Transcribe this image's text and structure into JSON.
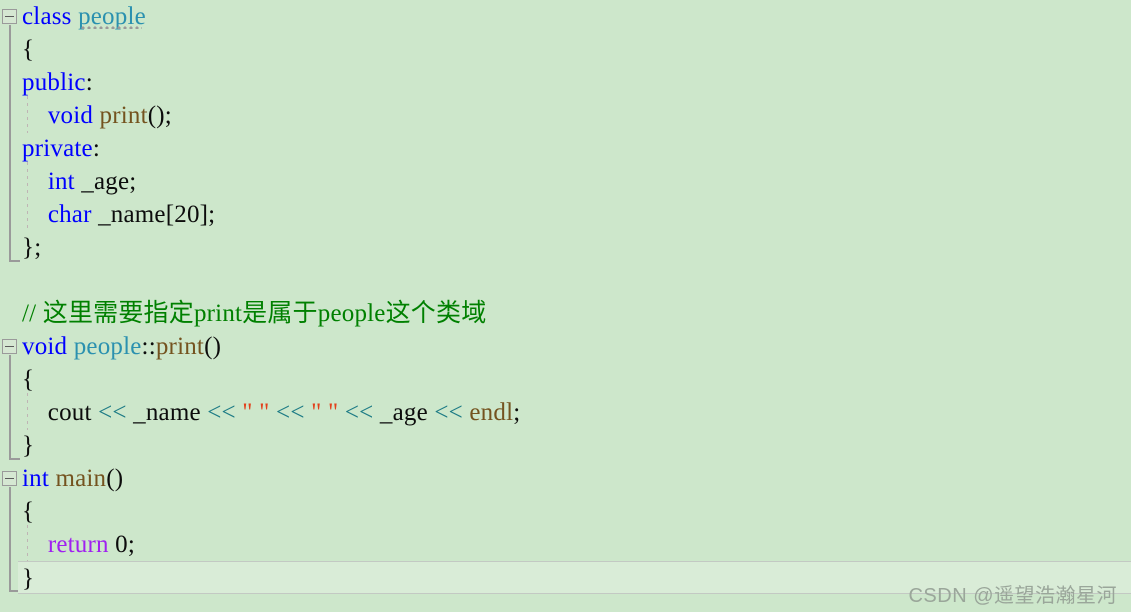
{
  "editor": {
    "background_color": "#cde7cb",
    "current_line_color": "#d9ecd7",
    "language": "C++"
  },
  "palette": {
    "keyword": "#0000ff",
    "user_type": "#2b91af",
    "function": "#74531f",
    "return_keyword": "#a020f0",
    "stream_operator": "#1d7b85",
    "string": "#e2401b",
    "comment": "#008000",
    "plain": "#0c0c0c",
    "fold_marker": "#9a9a9a",
    "watermark": "#9aa69a"
  },
  "code": {
    "lines": [
      {
        "n": 1,
        "indent": 0,
        "fold": "open",
        "tokens": [
          {
            "t": "class",
            "c": "kw"
          },
          {
            "t": " ",
            "c": "pl"
          },
          {
            "t": "people",
            "c": "type",
            "hint": true
          }
        ]
      },
      {
        "n": 2,
        "indent": 0,
        "tokens": [
          {
            "t": "{",
            "c": "pl"
          }
        ]
      },
      {
        "n": 3,
        "indent": 0,
        "tokens": [
          {
            "t": "public",
            "c": "kw"
          },
          {
            "t": ":",
            "c": "pl"
          }
        ]
      },
      {
        "n": 4,
        "indent": 1,
        "tokens": [
          {
            "t": "    ",
            "c": "pl"
          },
          {
            "t": "void",
            "c": "kw"
          },
          {
            "t": " ",
            "c": "pl"
          },
          {
            "t": "print",
            "c": "fn"
          },
          {
            "t": "();",
            "c": "pl"
          }
        ]
      },
      {
        "n": 5,
        "indent": 0,
        "tokens": [
          {
            "t": "private",
            "c": "kw"
          },
          {
            "t": ":",
            "c": "pl"
          }
        ]
      },
      {
        "n": 6,
        "indent": 1,
        "tokens": [
          {
            "t": "    ",
            "c": "pl"
          },
          {
            "t": "int",
            "c": "kw"
          },
          {
            "t": " _age;",
            "c": "pl"
          }
        ]
      },
      {
        "n": 7,
        "indent": 1,
        "tokens": [
          {
            "t": "    ",
            "c": "pl"
          },
          {
            "t": "char",
            "c": "kw"
          },
          {
            "t": " _name[20];",
            "c": "pl"
          }
        ]
      },
      {
        "n": 8,
        "indent": 0,
        "tokens": [
          {
            "t": "};",
            "c": "pl"
          }
        ]
      },
      {
        "n": 9,
        "indent": 0,
        "tokens": [
          {
            "t": "",
            "c": "pl"
          }
        ]
      },
      {
        "n": 10,
        "indent": 0,
        "tokens": [
          {
            "t": "// 这里需要指定print是属于people这个类域",
            "c": "cmt"
          }
        ]
      },
      {
        "n": 11,
        "indent": 0,
        "fold": "open",
        "tokens": [
          {
            "t": "void",
            "c": "kw"
          },
          {
            "t": " ",
            "c": "pl"
          },
          {
            "t": "people",
            "c": "type"
          },
          {
            "t": "::",
            "c": "pl"
          },
          {
            "t": "print",
            "c": "fn"
          },
          {
            "t": "()",
            "c": "pl"
          }
        ]
      },
      {
        "n": 12,
        "indent": 0,
        "tokens": [
          {
            "t": "{",
            "c": "pl"
          }
        ]
      },
      {
        "n": 13,
        "indent": 1,
        "tokens": [
          {
            "t": "    cout ",
            "c": "pl"
          },
          {
            "t": "<<",
            "c": "op"
          },
          {
            "t": " _name ",
            "c": "pl"
          },
          {
            "t": "<<",
            "c": "op"
          },
          {
            "t": " \" \" ",
            "c": "str"
          },
          {
            "t": "<<",
            "c": "op"
          },
          {
            "t": " \" \" ",
            "c": "str"
          },
          {
            "t": "<<",
            "c": "op"
          },
          {
            "t": " _age ",
            "c": "pl"
          },
          {
            "t": "<<",
            "c": "op"
          },
          {
            "t": " ",
            "c": "pl"
          },
          {
            "t": "endl",
            "c": "fn"
          },
          {
            "t": ";",
            "c": "pl"
          }
        ]
      },
      {
        "n": 14,
        "indent": 0,
        "tokens": [
          {
            "t": "}",
            "c": "pl"
          }
        ]
      },
      {
        "n": 15,
        "indent": 0,
        "fold": "open",
        "tokens": [
          {
            "t": "int",
            "c": "kw"
          },
          {
            "t": " ",
            "c": "pl"
          },
          {
            "t": "main",
            "c": "fn"
          },
          {
            "t": "()",
            "c": "pl"
          }
        ]
      },
      {
        "n": 16,
        "indent": 0,
        "tokens": [
          {
            "t": "{",
            "c": "pl"
          }
        ]
      },
      {
        "n": 17,
        "indent": 1,
        "tokens": [
          {
            "t": "    ",
            "c": "pl"
          },
          {
            "t": "return",
            "c": "ret"
          },
          {
            "t": " 0;",
            "c": "pl"
          }
        ]
      },
      {
        "n": 18,
        "indent": 0,
        "current": true,
        "tokens": [
          {
            "t": "}",
            "c": "pl"
          }
        ]
      }
    ]
  },
  "watermark": {
    "text": "CSDN @遥望浩瀚星河"
  }
}
